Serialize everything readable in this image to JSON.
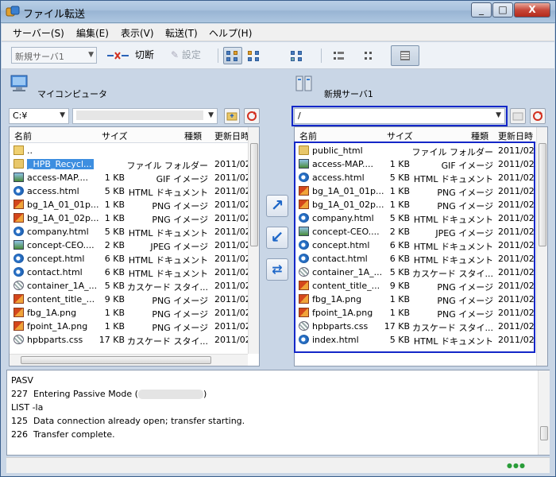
{
  "window": {
    "title": "ファイル転送",
    "caption_buttons": [
      "_",
      "□",
      "X"
    ]
  },
  "menu": [
    "サーバー(S)",
    "編集(E)",
    "表示(V)",
    "転送(T)",
    "ヘルプ(H)"
  ],
  "toolbar": {
    "server_value": "新規サーバ1",
    "disconnect_label": "切断",
    "settings_label": "設定"
  },
  "local": {
    "title": "マイコンピュータ",
    "path": "C:¥",
    "columns": [
      "名前",
      "サイズ",
      "種類",
      "更新日時"
    ],
    "rows": [
      {
        "icon": "up",
        "name": "..",
        "size": "",
        "type": "",
        "date": ""
      },
      {
        "icon": "folder",
        "name": "_HPB_Recycl...",
        "size": "",
        "type": "ファイル フォルダー",
        "date": "2011/02"
      },
      {
        "icon": "gif",
        "name": "access-MAP....",
        "size": "1 KB",
        "type": "GIF イメージ",
        "date": "2011/02"
      },
      {
        "icon": "ie",
        "name": "access.html",
        "size": "5 KB",
        "type": "HTML ドキュメント",
        "date": "2011/02"
      },
      {
        "icon": "img",
        "name": "bg_1A_01_01p...",
        "size": "1 KB",
        "type": "PNG イメージ",
        "date": "2011/02"
      },
      {
        "icon": "img",
        "name": "bg_1A_01_02p...",
        "size": "1 KB",
        "type": "PNG イメージ",
        "date": "2011/02"
      },
      {
        "icon": "ie",
        "name": "company.html",
        "size": "5 KB",
        "type": "HTML ドキュメント",
        "date": "2011/02"
      },
      {
        "icon": "gif",
        "name": "concept-CEO....",
        "size": "2 KB",
        "type": "JPEG イメージ",
        "date": "2011/02"
      },
      {
        "icon": "ie",
        "name": "concept.html",
        "size": "6 KB",
        "type": "HTML ドキュメント",
        "date": "2011/02"
      },
      {
        "icon": "ie",
        "name": "contact.html",
        "size": "6 KB",
        "type": "HTML ドキュメント",
        "date": "2011/02"
      },
      {
        "icon": "css",
        "name": "container_1A_...",
        "size": "5 KB",
        "type": "カスケード スタイ...",
        "date": "2011/02"
      },
      {
        "icon": "img",
        "name": "content_title_...",
        "size": "9 KB",
        "type": "PNG イメージ",
        "date": "2011/02"
      },
      {
        "icon": "img",
        "name": "fbg_1A.png",
        "size": "1 KB",
        "type": "PNG イメージ",
        "date": "2011/02"
      },
      {
        "icon": "img",
        "name": "fpoint_1A.png",
        "size": "1 KB",
        "type": "PNG イメージ",
        "date": "2011/02"
      },
      {
        "icon": "css",
        "name": "hpbparts.css",
        "size": "17 KB",
        "type": "カスケード スタイ...",
        "date": "2011/02"
      }
    ]
  },
  "remote": {
    "title": "新規サーバ1",
    "path": "/",
    "columns": [
      "名前",
      "サイズ",
      "種類",
      "更新日時"
    ],
    "rows": [
      {
        "icon": "folder",
        "name": "public_html",
        "size": "",
        "type": "ファイル フォルダー",
        "date": "2011/02"
      },
      {
        "icon": "gif",
        "name": "access-MAP....",
        "size": "1 KB",
        "type": "GIF イメージ",
        "date": "2011/02"
      },
      {
        "icon": "ie",
        "name": "access.html",
        "size": "5 KB",
        "type": "HTML ドキュメント",
        "date": "2011/02"
      },
      {
        "icon": "img",
        "name": "bg_1A_01_01p...",
        "size": "1 KB",
        "type": "PNG イメージ",
        "date": "2011/02"
      },
      {
        "icon": "img",
        "name": "bg_1A_01_02p...",
        "size": "1 KB",
        "type": "PNG イメージ",
        "date": "2011/02"
      },
      {
        "icon": "ie",
        "name": "company.html",
        "size": "5 KB",
        "type": "HTML ドキュメント",
        "date": "2011/02"
      },
      {
        "icon": "gif",
        "name": "concept-CEO....",
        "size": "2 KB",
        "type": "JPEG イメージ",
        "date": "2011/02"
      },
      {
        "icon": "ie",
        "name": "concept.html",
        "size": "6 KB",
        "type": "HTML ドキュメント",
        "date": "2011/02"
      },
      {
        "icon": "ie",
        "name": "contact.html",
        "size": "6 KB",
        "type": "HTML ドキュメント",
        "date": "2011/02"
      },
      {
        "icon": "css",
        "name": "container_1A_...",
        "size": "5 KB",
        "type": "カスケード スタイ...",
        "date": "2011/02"
      },
      {
        "icon": "img",
        "name": "content_title_...",
        "size": "9 KB",
        "type": "PNG イメージ",
        "date": "2011/02"
      },
      {
        "icon": "img",
        "name": "fbg_1A.png",
        "size": "1 KB",
        "type": "PNG イメージ",
        "date": "2011/02"
      },
      {
        "icon": "img",
        "name": "fpoint_1A.png",
        "size": "1 KB",
        "type": "PNG イメージ",
        "date": "2011/02"
      },
      {
        "icon": "css",
        "name": "hpbparts.css",
        "size": "17 KB",
        "type": "カスケード スタイ...",
        "date": "2011/02"
      },
      {
        "icon": "ie",
        "name": "index.html",
        "size": "5 KB",
        "type": "HTML ドキュメント",
        "date": "2011/02"
      }
    ]
  },
  "log": {
    "line1": "PASV",
    "line2_prefix": "227  Entering Passive Mode (",
    "line2_suffix": ")",
    "line3": "LIST -la",
    "line4": "125  Data connection already open; transfer starting.",
    "line5": "226  Transfer complete."
  },
  "status": {
    "indicator": "●●●"
  }
}
